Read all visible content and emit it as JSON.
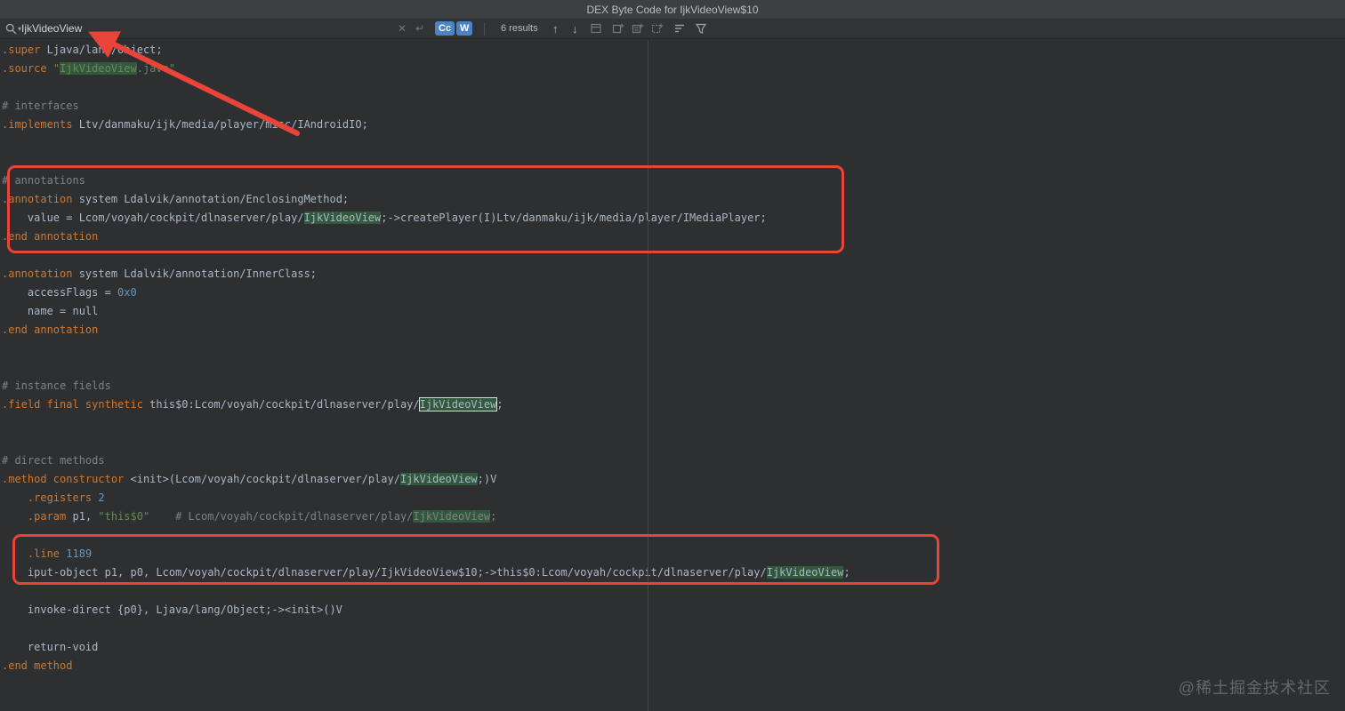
{
  "window": {
    "title": "DEX Byte Code for IjkVideoView$10"
  },
  "search": {
    "query": "IjkVideoView",
    "results": "6 results",
    "match_case_label": "Cc",
    "words_label": "W"
  },
  "colors": {
    "annotation_red": "#e8443a",
    "highlight_green": "#32593d",
    "accent_blue": "#4a84c4",
    "keyword_orange": "#cc7832",
    "text_default": "#a9b7c6",
    "comment_gray": "#808080",
    "string_green": "#6a8759",
    "number_blue": "#6897bb"
  },
  "watermark": "@稀土掘金技术社区",
  "code": {
    "lines": [
      [
        {
          "t": ".super",
          "s": "kw"
        },
        {
          "t": " Ljava/lang/Object;",
          "s": "txt"
        }
      ],
      [
        {
          "t": ".source",
          "s": "kw"
        },
        {
          "t": " ",
          "s": "txt"
        },
        {
          "t": "\"",
          "s": "str"
        },
        {
          "t": "IjkVideoView",
          "s": "str",
          "h": "match"
        },
        {
          "t": ".java\"",
          "s": "str"
        }
      ],
      [],
      [
        {
          "t": "# interfaces",
          "s": "cmt"
        }
      ],
      [
        {
          "t": ".implements",
          "s": "kw"
        },
        {
          "t": " Ltv/danmaku/ijk/media/player/misc/IAndroidIO;",
          "s": "txt"
        }
      ],
      [],
      [],
      [
        {
          "t": "# annotations",
          "s": "cmt"
        }
      ],
      [
        {
          "t": ".annotation",
          "s": "kw"
        },
        {
          "t": " system Ldalvik/annotation/EnclosingMethod;",
          "s": "txt"
        }
      ],
      [
        {
          "t": "    value = Lcom/voyah/cockpit/dlnaserver/play/",
          "s": "txt"
        },
        {
          "t": "IjkVideoView",
          "s": "txt",
          "h": "match"
        },
        {
          "t": ";->createPlayer(I)Ltv/danmaku/ijk/media/player/IMediaPlayer;",
          "s": "txt"
        }
      ],
      [
        {
          "t": ".end annotation",
          "s": "kw"
        }
      ],
      [],
      [
        {
          "t": ".annotation",
          "s": "kw"
        },
        {
          "t": " system Ldalvik/annotation/InnerClass;",
          "s": "txt"
        }
      ],
      [
        {
          "t": "    accessFlags = ",
          "s": "txt"
        },
        {
          "t": "0x0",
          "s": "num"
        }
      ],
      [
        {
          "t": "    name = null",
          "s": "txt"
        }
      ],
      [
        {
          "t": ".end annotation",
          "s": "kw"
        }
      ],
      [],
      [],
      [
        {
          "t": "# instance fields",
          "s": "cmt"
        }
      ],
      [
        {
          "t": ".field final synthetic",
          "s": "kw"
        },
        {
          "t": " this$0:Lcom/voyah/cockpit/dlnaserver/play/",
          "s": "txt"
        },
        {
          "t": "IjkVideoView",
          "s": "txt",
          "h": "current"
        },
        {
          "t": ";",
          "s": "txt"
        }
      ],
      [],
      [],
      [
        {
          "t": "# direct methods",
          "s": "cmt"
        }
      ],
      [
        {
          "t": ".method constructor",
          "s": "kw"
        },
        {
          "t": " <init>(Lcom/voyah/cockpit/dlnaserver/play/",
          "s": "txt"
        },
        {
          "t": "IjkVideoView",
          "s": "txt",
          "h": "match"
        },
        {
          "t": ";)V",
          "s": "txt"
        }
      ],
      [
        {
          "t": "    ",
          "s": "txt"
        },
        {
          "t": ".registers",
          "s": "kw"
        },
        {
          "t": " ",
          "s": "txt"
        },
        {
          "t": "2",
          "s": "num"
        }
      ],
      [
        {
          "t": "    ",
          "s": "txt"
        },
        {
          "t": ".param",
          "s": "kw"
        },
        {
          "t": " p1, ",
          "s": "txt"
        },
        {
          "t": "\"this$0\"",
          "s": "str"
        },
        {
          "t": "    ",
          "s": "txt"
        },
        {
          "t": "# Lcom/voyah/cockpit/dlnaserver/play/",
          "s": "cmt"
        },
        {
          "t": "IjkVideoView",
          "s": "cmt",
          "h": "match"
        },
        {
          "t": ";",
          "s": "cmt"
        }
      ],
      [],
      [
        {
          "t": "    ",
          "s": "txt"
        },
        {
          "t": ".line",
          "s": "kw"
        },
        {
          "t": " ",
          "s": "txt"
        },
        {
          "t": "1189",
          "s": "num"
        }
      ],
      [
        {
          "t": "    iput-object p1, p0, Lcom/voyah/cockpit/dlnaserver/play/IjkVideoView$10;->this$0:Lcom/voyah/cockpit/dlnaserver/play/",
          "s": "txt"
        },
        {
          "t": "IjkVideoView",
          "s": "txt",
          "h": "match"
        },
        {
          "t": ";",
          "s": "txt"
        }
      ],
      [],
      [
        {
          "t": "    invoke-direct {p0}, Ljava/lang/Object;-><init>()V",
          "s": "txt"
        }
      ],
      [],
      [
        {
          "t": "    return-void",
          "s": "txt"
        }
      ],
      [
        {
          "t": ".end method",
          "s": "kw"
        }
      ]
    ]
  }
}
